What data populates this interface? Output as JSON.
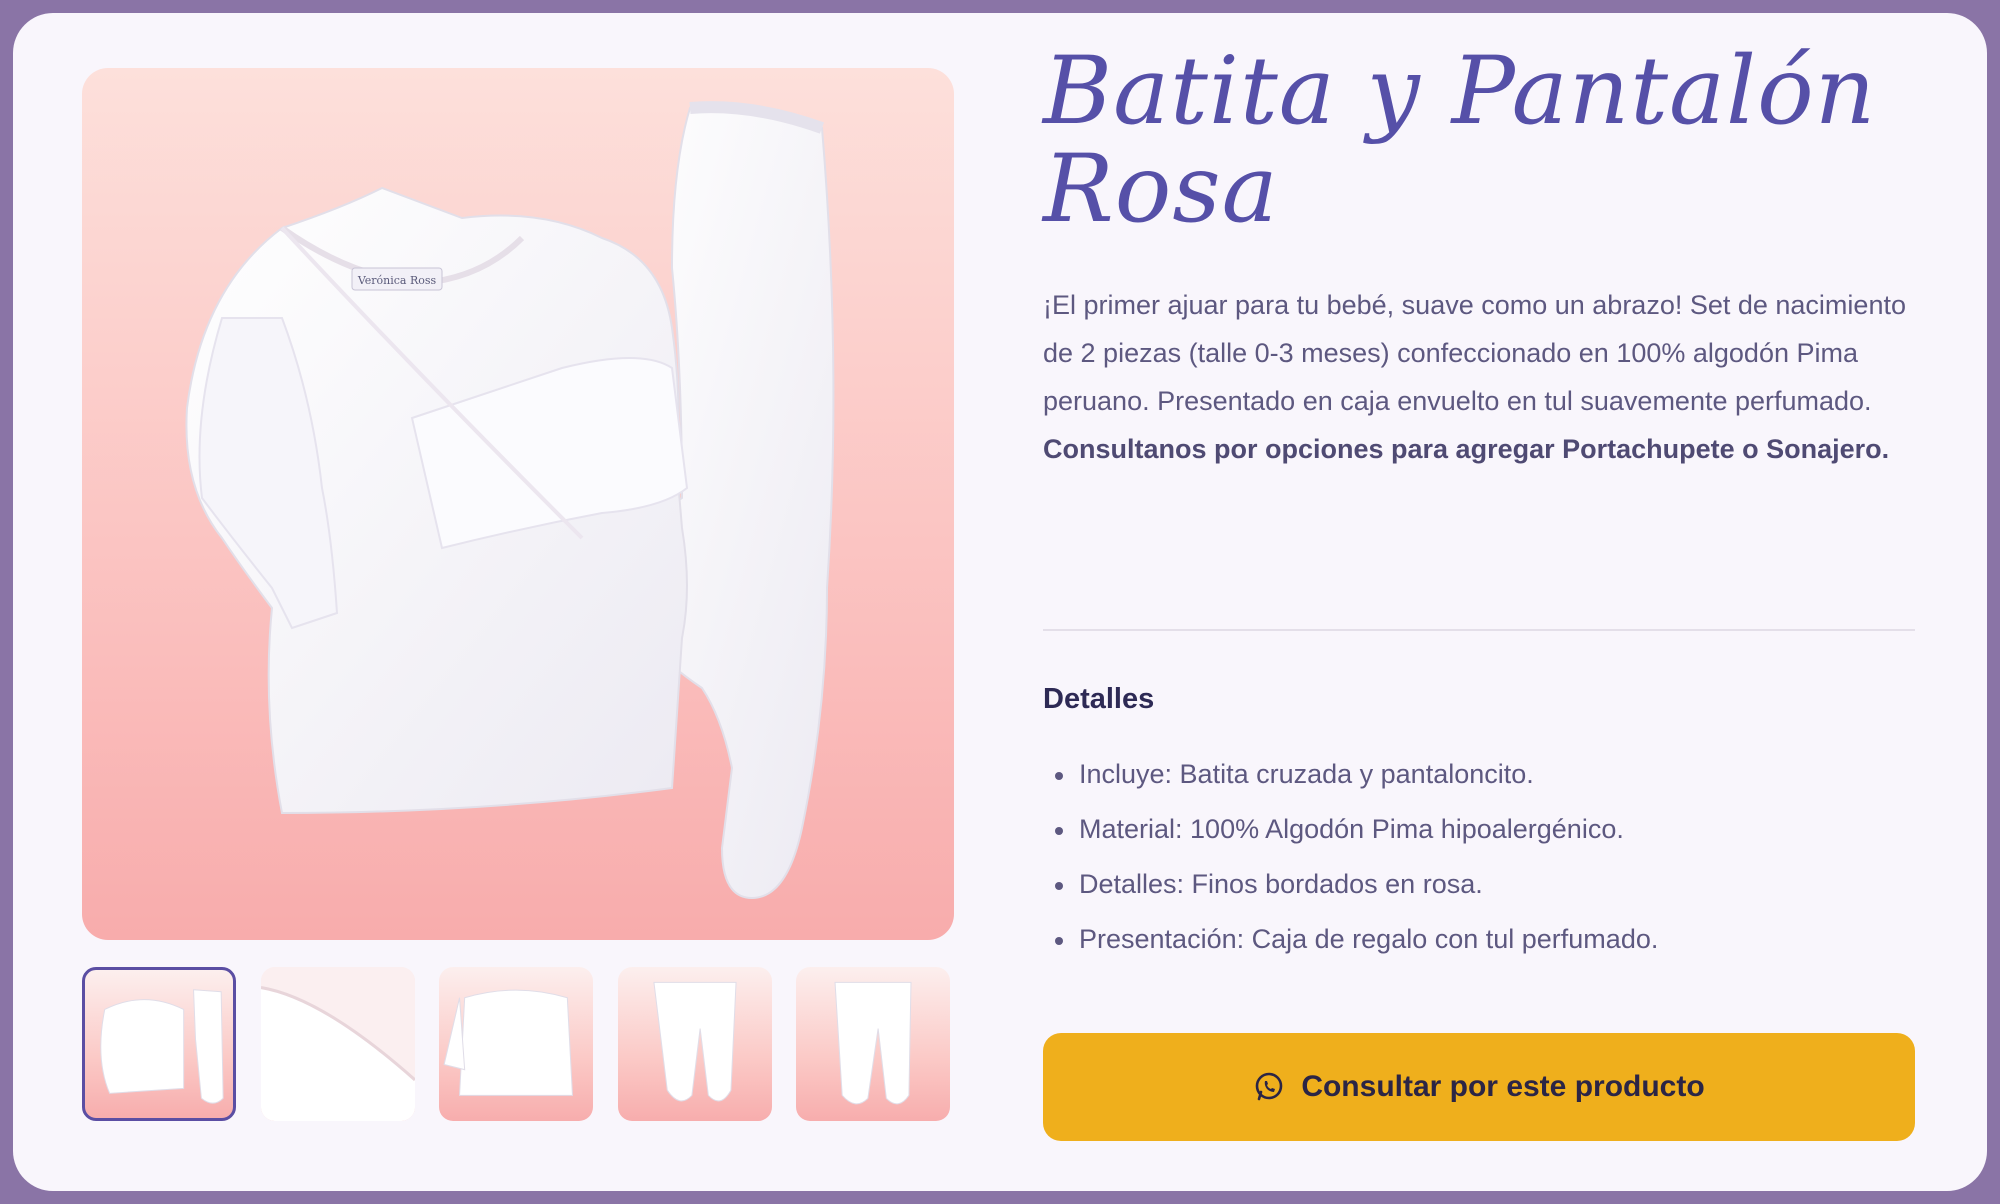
{
  "product": {
    "title": "Batita y Pantalón Rosa",
    "description": "¡El primer ajuar para tu bebé, suave como un abrazo! Set de nacimiento de 2 piezas (talle 0-3 meses) confeccionado en 100% algodón Pima peruano. Presentado en caja envuelto en tul suavemente perfumado.",
    "note": "Consultanos por opciones para agregar Portachupete o Sonajero.",
    "details_title": "Detalles",
    "details": [
      "Incluye: Batita cruzada y pantaloncito.",
      "Material: 100% Algodón Pima hipoalergénico.",
      "Detalles: Finos bordados en rosa.",
      "Presentación: Caja de regalo con tul perfumado."
    ],
    "cta_label": "Consultar por este producto",
    "cta_icon": "whatsapp-icon"
  },
  "gallery": {
    "main_label": "Verónica Ross",
    "thumbnails": [
      "set-front",
      "batita-closeup",
      "batita-side",
      "pantalon-front",
      "pantalon-back"
    ],
    "active_index": 0
  },
  "colors": {
    "accent": "#5650a8",
    "cta": "#efaf1c",
    "frame": "#8a74a6"
  }
}
